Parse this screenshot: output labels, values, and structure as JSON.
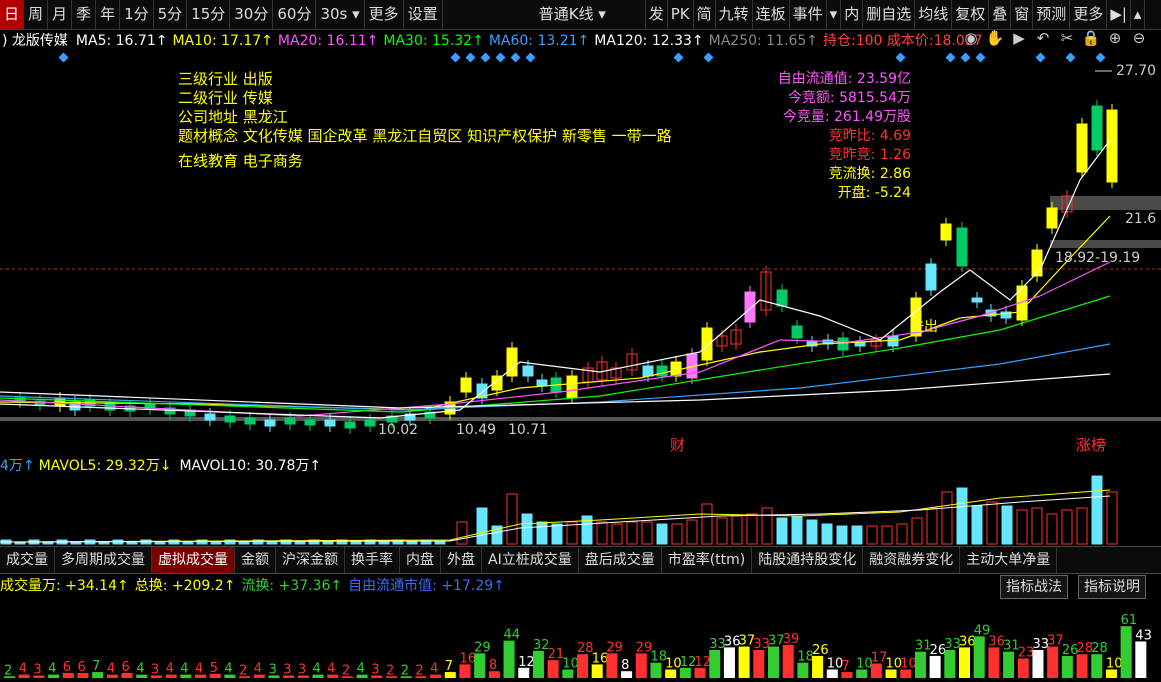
{
  "toolbar": {
    "periods": [
      "日",
      "周",
      "月",
      "季",
      "年",
      "1分",
      "5分",
      "15分",
      "30分",
      "60分",
      "30s ▾",
      "更多",
      "设置"
    ],
    "active": 0,
    "kline_select": "普通K线",
    "right_tools": [
      "发",
      "PK",
      "简",
      "九转",
      "连板",
      "事件",
      "▾",
      "内",
      "删自选",
      "均线",
      "复权",
      "叠",
      "窗",
      "预测",
      "更多",
      "▶|",
      "▴"
    ]
  },
  "ma_line": {
    "name": "龙版传媒",
    "items": [
      {
        "text": "MA5: 16.71↑",
        "color": "#ffffff"
      },
      {
        "text": "MA10: 17.17↑",
        "color": "#ffff00"
      },
      {
        "text": "MA20: 16.11↑",
        "color": "#ff55ff"
      },
      {
        "text": "MA30: 15.32↑",
        "color": "#00ff00"
      },
      {
        "text": "MA60: 13.21↑",
        "color": "#3aa0ff"
      },
      {
        "text": "MA120: 12.33↑",
        "color": "#ffffff"
      },
      {
        "text": "MA250: 11.65↑",
        "color": "#888888"
      },
      {
        "text": "持仓:100 成本价:18.037",
        "color": "#ff4040"
      }
    ],
    "icons": [
      "eye-icon",
      "hand-icon",
      "play-icon",
      "undo-icon",
      "scissors-icon",
      "lock-icon",
      "zoom-in-icon",
      "zoom-out-icon"
    ],
    "icon_glyphs": [
      "◉",
      "✋",
      "▶",
      "↶",
      "✂",
      "🔒",
      "⊕",
      "⊖"
    ]
  },
  "company_info": {
    "industry3": "三级行业  出版",
    "industry2": "二级行业  传媒",
    "address": "公司地址  黑龙江",
    "concepts": "题材概念  文化传媒  国企改革  黑龙江自贸区  知识产权保护  新零售  一带一路",
    "concepts2": "在线教育  电子商务"
  },
  "auction_info": [
    {
      "text": "自由流通值: 23.59亿",
      "color": "#ff55ff"
    },
    {
      "text": "今竞额: 5815.54万",
      "color": "#ff55ff"
    },
    {
      "text": "今竞量: 261.49万股",
      "color": "#ff55ff"
    },
    {
      "text": "竞昨比: 4.69",
      "color": "#ff3030"
    },
    {
      "text": "竞昨竞: 1.26",
      "color": "#ff3030"
    },
    {
      "text": "竞流换: 2.86",
      "color": "#ffff00"
    },
    {
      "text": "开盘: -5.24",
      "color": "#ffff00"
    }
  ],
  "price_labels": {
    "high": "27.70",
    "right_cut": "21.6",
    "range": "18.92-19.19",
    "low1": "10.02",
    "low2": "10.49",
    "low3": "10.71",
    "event_cai": "财",
    "event_zhangbang": "涨榜",
    "jiangu": "进出"
  },
  "volume_header": {
    "prefix": "4万↑",
    "mavol5": "MAVOL5: 29.32万↓",
    "mavol10": "MAVOL10: 30.78万↑"
  },
  "indicator_tabs": [
    "成交量",
    "多周期成交量",
    "虚拟成交量",
    "金额",
    "沪深金额",
    "换手率",
    "内盘",
    "外盘",
    "AI立桩成交量",
    "盘后成交量",
    "市盈率(ttm)",
    "陆股通持股变化",
    "融资融券变化",
    "主动大单净量"
  ],
  "indicator_active": 2,
  "indicator_header": [
    {
      "text": "成交量万: +34.14↑",
      "color": "#ffff00"
    },
    {
      "text": "总换: +209.2↑",
      "color": "#ffff00"
    },
    {
      "text": "流换: +37.36↑",
      "color": "#33cc33"
    },
    {
      "text": "自由流通市值: +17.29↑",
      "color": "#3a6cff"
    }
  ],
  "indicator_buttons": [
    "指标战法",
    "指标说明"
  ],
  "indicator_values": [
    2,
    4,
    3,
    4,
    6,
    6,
    7,
    4,
    6,
    4,
    3,
    4,
    4,
    4,
    5,
    4,
    2,
    4,
    3,
    3,
    3,
    4,
    4,
    2,
    4,
    3,
    2,
    2,
    2,
    4,
    7,
    16,
    29,
    8,
    44,
    12,
    32,
    21,
    10,
    28,
    16,
    29,
    8,
    29,
    18,
    10,
    12,
    12,
    33,
    36,
    37,
    33,
    37,
    39,
    18,
    26,
    10,
    7,
    10,
    17,
    10,
    10,
    31,
    26,
    33,
    36,
    49,
    36,
    31,
    23,
    33,
    37,
    26,
    28,
    28,
    10,
    61,
    43
  ],
  "indicator_colors": {
    "up": "#ff3030",
    "down": "#33cc33",
    "highlight": "#ffffff",
    "special": "#ffff00"
  },
  "ma_colors": {
    "ma5": "#ffffff",
    "ma10": "#ffff00",
    "ma20": "#ff55ff",
    "ma30": "#00ff00",
    "ma60": "#3aa0ff",
    "ma120": "#ffffff"
  },
  "candle_colors": {
    "up": "#ffff00",
    "up_hollow": "#ff3030",
    "down": "#00cc66",
    "pink": "#ff77ff",
    "cyan": "#66e6ff"
  }
}
